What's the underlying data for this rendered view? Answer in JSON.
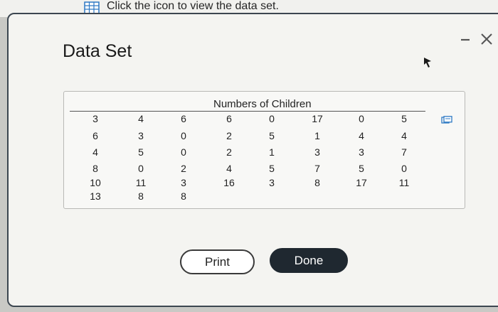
{
  "instruction": {
    "text": "Click the icon to view the data set.",
    "icon": "data-table-icon"
  },
  "dialog": {
    "title": "Data Set",
    "minimize_icon": "minimize-icon",
    "close_icon": "close-icon"
  },
  "table": {
    "caption": "Numbers of Children",
    "copy_icon": "copy-icon",
    "columns": [
      [
        "3",
        "6",
        "4",
        "8",
        "10",
        "13"
      ],
      [
        "4",
        "3",
        "5",
        "0",
        "11",
        "8"
      ],
      [
        "6",
        "0",
        "0",
        "2",
        "3",
        "8"
      ],
      [
        "6",
        "2",
        "2",
        "4",
        "16"
      ],
      [
        "0",
        "5",
        "1",
        "5",
        "3"
      ],
      [
        "17",
        "1",
        "3",
        "7",
        "8"
      ],
      [
        "0",
        "4",
        "3",
        "5",
        "17"
      ],
      [
        "5",
        "4",
        "7",
        "0",
        "11"
      ]
    ]
  },
  "buttons": {
    "print": "Print",
    "done": "Done"
  },
  "colors": {
    "done_background": "#1f2830",
    "dialog_border": "#3c4650",
    "icon_blue": "#2e79c4"
  }
}
